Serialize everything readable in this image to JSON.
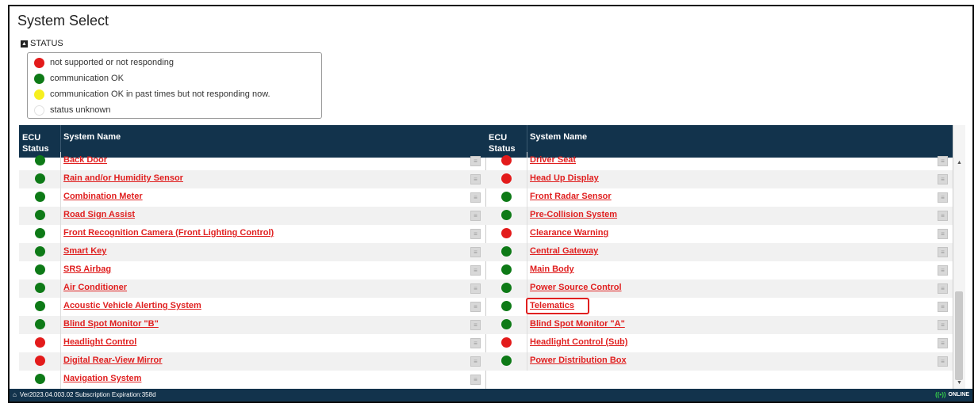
{
  "window": {
    "title": "System Select"
  },
  "status_section": {
    "toggle_label": "STATUS",
    "legend": [
      {
        "color": "#e31b1b",
        "text": "not supported or not responding"
      },
      {
        "color": "#0e7a17",
        "text": "communication OK"
      },
      {
        "color": "#f6ef1e",
        "text": "communication OK in past times but not responding now."
      },
      {
        "color": "#ffffff",
        "text": "status unknown"
      }
    ]
  },
  "table": {
    "header": {
      "ecu_status_line1": "ECU",
      "ecu_status_line2": "Status",
      "system_name": "System Name"
    },
    "left": [
      {
        "status": "green",
        "name": "Back Door"
      },
      {
        "status": "green",
        "name": "Rain and/or Humidity Sensor"
      },
      {
        "status": "green",
        "name": "Combination Meter"
      },
      {
        "status": "green",
        "name": "Road Sign Assist"
      },
      {
        "status": "green",
        "name": "Front Recognition Camera (Front Lighting Control)"
      },
      {
        "status": "green",
        "name": "Smart Key"
      },
      {
        "status": "green",
        "name": "SRS Airbag"
      },
      {
        "status": "green",
        "name": "Air Conditioner"
      },
      {
        "status": "green",
        "name": "Acoustic Vehicle Alerting System"
      },
      {
        "status": "green",
        "name": "Blind Spot Monitor \"B\""
      },
      {
        "status": "red",
        "name": "Headlight Control"
      },
      {
        "status": "red",
        "name": "Digital Rear-View Mirror"
      },
      {
        "status": "green",
        "name": "Navigation System"
      }
    ],
    "right": [
      {
        "status": "red",
        "name": "Driver Seat"
      },
      {
        "status": "red",
        "name": "Head Up Display"
      },
      {
        "status": "green",
        "name": "Front Radar Sensor"
      },
      {
        "status": "green",
        "name": "Pre-Collision System"
      },
      {
        "status": "red",
        "name": "Clearance Warning"
      },
      {
        "status": "green",
        "name": "Central Gateway"
      },
      {
        "status": "green",
        "name": "Main Body"
      },
      {
        "status": "green",
        "name": "Power Source Control"
      },
      {
        "status": "green",
        "name": "Telematics",
        "highlighted": true
      },
      {
        "status": "green",
        "name": "Blind Spot Monitor \"A\""
      },
      {
        "status": "red",
        "name": "Headlight Control (Sub)"
      },
      {
        "status": "green",
        "name": "Power Distribution Box"
      }
    ],
    "status_colors": {
      "green": "#0e7a17",
      "red": "#e31b1b"
    },
    "doc_icon": "document-icon"
  },
  "footer": {
    "version_text": "Ver2023.04.003.02  Subscription Expiration:358d",
    "online_label": "ONLINE"
  }
}
